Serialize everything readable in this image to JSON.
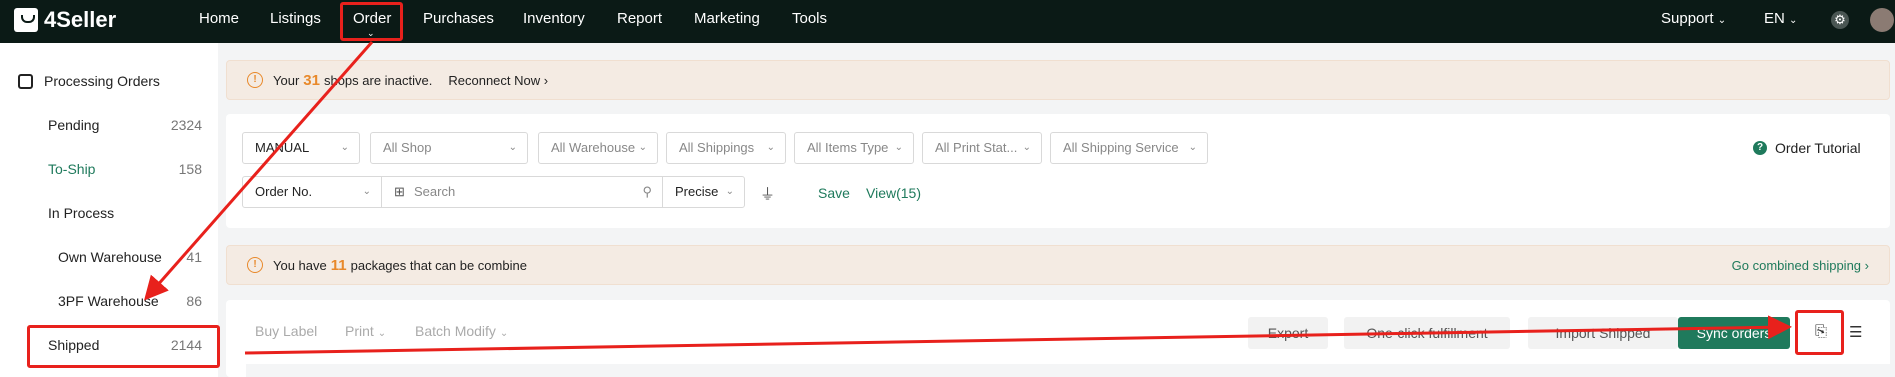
{
  "brand": "4Seller",
  "nav": [
    "Home",
    "Listings",
    "Order",
    "Purchases",
    "Inventory",
    "Report",
    "Marketing",
    "Tools"
  ],
  "topright": {
    "support": "Support",
    "lang": "EN"
  },
  "sidebar": {
    "header": "Processing Orders",
    "items": [
      {
        "label": "Pending",
        "count": "2324"
      },
      {
        "label": "To-Ship",
        "count": "158"
      },
      {
        "label": "In Process",
        "count": ""
      },
      {
        "label": "Own Warehouse",
        "count": "41"
      },
      {
        "label": "3PF Warehouse",
        "count": "86"
      },
      {
        "label": "Shipped",
        "count": "2144"
      }
    ]
  },
  "alert1": {
    "prefix": "Your",
    "num": "31",
    "suffix": "shops are inactive.",
    "action": "Reconnect Now"
  },
  "filters": {
    "row1": [
      "MANUAL",
      "All Shop",
      "All Warehouse",
      "All Shippings",
      "All Items Type",
      "All Print Stat...",
      "All Shipping Service"
    ],
    "order_no": "Order No.",
    "search_placeholder": "Search",
    "precise": "Precise",
    "save": "Save",
    "view": "View(15)",
    "tutorial": "Order Tutorial"
  },
  "alert2": {
    "prefix": "You have",
    "num": "11",
    "suffix": "packages that can be combine",
    "action": "Go combined shipping"
  },
  "toolbar": {
    "buy_label": "Buy Label",
    "print": "Print",
    "batch_modify": "Batch Modify",
    "export": "Export",
    "one_click": "One-click fulfillment",
    "import_shipped": "Import Shipped",
    "sync_orders": "Sync orders"
  },
  "colors": {
    "accent": "#1f7a5c",
    "warning": "#e8892b",
    "annotation": "#e8211c"
  }
}
